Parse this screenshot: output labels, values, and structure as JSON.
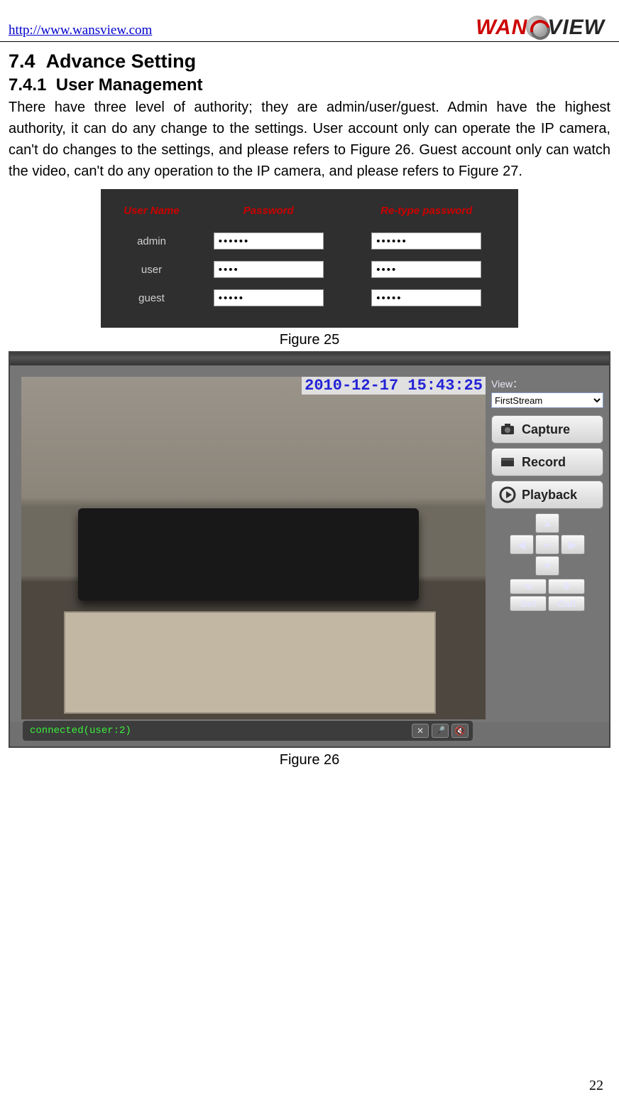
{
  "header": {
    "link_text": "http://www.wansview.com",
    "logo_pre": "WAN",
    "logo_post": "VIEW"
  },
  "section": {
    "heading_num": "7.4",
    "heading": "Advance Setting",
    "sub_num": "7.4.1",
    "sub_heading": "User Management",
    "paragraph": "There have three level of authority; they are admin/user/guest. Admin have the highest authority, it can do any change to the settings. User account only can operate the IP camera, can't do changes to the settings, and please refers to Figure 26. Guest account only can watch the video, can't do any operation to the IP camera, and please refers to Figure 27."
  },
  "fig25": {
    "headers": [
      "User Name",
      "Password",
      "Re-type password"
    ],
    "rows": [
      {
        "name": "admin",
        "pwd": "••••••",
        "pwd2": "••••••"
      },
      {
        "name": "user",
        "pwd": "••••",
        "pwd2": "••••"
      },
      {
        "name": "guest",
        "pwd": "•••••",
        "pwd2": "•••••"
      }
    ],
    "caption": "Figure 25"
  },
  "fig26": {
    "timestamp": "2010-12-17 15:43:25",
    "view_label": "View：",
    "view_value": "FirstStream",
    "buttons": {
      "capture": "Capture",
      "record": "Record",
      "playback": "Playback"
    },
    "ptz": {
      "set": "Set",
      "call": "Call"
    },
    "status": "connected(user:2)",
    "caption": "Figure 26"
  },
  "page_number": "22"
}
